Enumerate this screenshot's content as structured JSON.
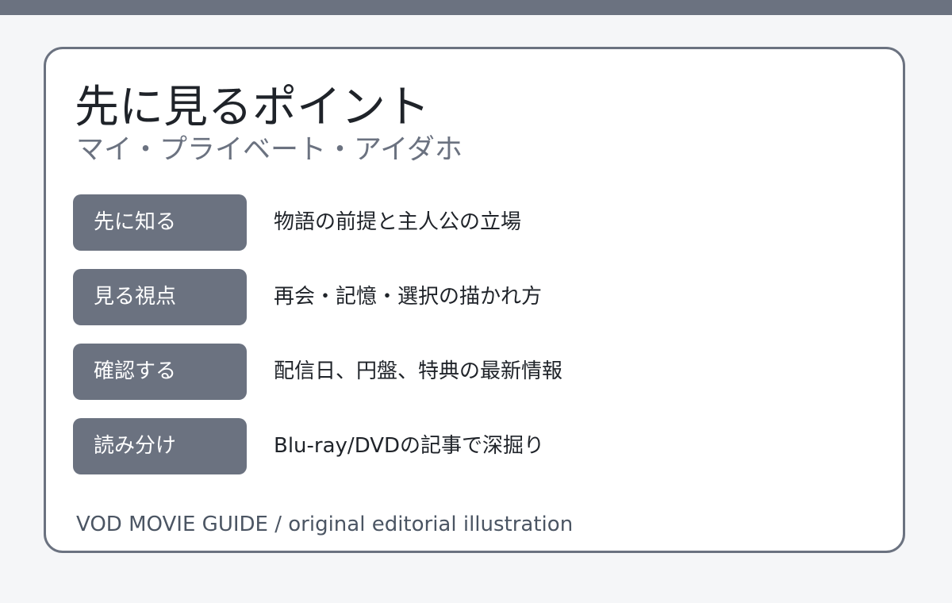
{
  "colors": {
    "accent": "#6b7280",
    "background": "#f5f6f8",
    "card": "#ffffff",
    "text": "#1f2329"
  },
  "header": {
    "title": "先に見るポイント",
    "subtitle": "マイ・プライベート・アイダホ"
  },
  "points": [
    {
      "label": "先に知る",
      "value": "物語の前提と主人公の立場"
    },
    {
      "label": "見る視点",
      "value": "再会・記憶・選択の描かれ方"
    },
    {
      "label": "確認する",
      "value": "配信日、円盤、特典の最新情報"
    },
    {
      "label": "読み分け",
      "value": "Blu-ray/DVDの記事で深掘り"
    }
  ],
  "footer": {
    "credit": "VOD MOVIE GUIDE / original editorial illustration"
  }
}
